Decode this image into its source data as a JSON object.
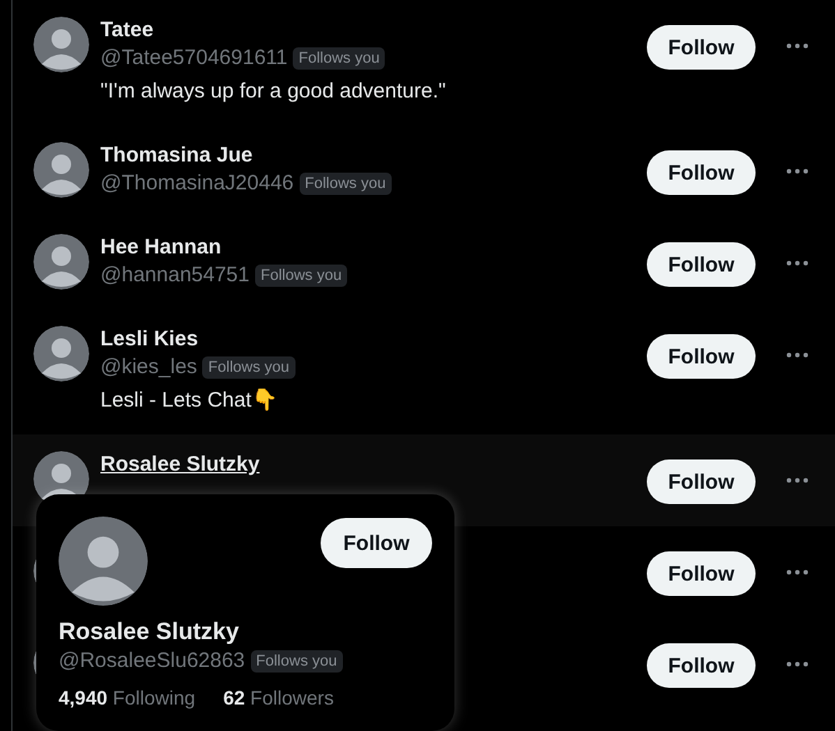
{
  "users": [
    {
      "kind": "listed",
      "name": "Tatee",
      "handle": "@Tatee5704691611",
      "badge": "Follows you",
      "bio": "\"I'm always up for a good adventure.\"",
      "hovered": false,
      "button": "Follow"
    },
    {
      "kind": "listed",
      "name": "Thomasina Jue",
      "handle": "@ThomasinaJ20446",
      "badge": "Follows you",
      "hovered": false,
      "button": "Follow"
    },
    {
      "kind": "listed",
      "name": "Hee Hannan",
      "handle": "@hannan54751",
      "badge": "Follows you",
      "hovered": false,
      "button": "Follow"
    },
    {
      "kind": "listed",
      "name": "Lesli Kies",
      "handle": "@kies_les",
      "badge": "Follows you",
      "bio": "Lesli - Lets Chat👇",
      "hovered": false,
      "button": "Follow"
    },
    {
      "kind": "listed",
      "name": "Rosalee Slutzky",
      "hovered": true,
      "button": "Follow"
    },
    {
      "kind": "covered",
      "button": "Follow"
    },
    {
      "kind": "covered",
      "button": "Follow"
    }
  ],
  "hover_card": {
    "button": "Follow",
    "name": "Rosalee Slutzky",
    "handle": "@RosaleeSlu62863",
    "badge": "Follows you",
    "following_count": "4,940",
    "following_label": "Following",
    "followers_count": "62",
    "followers_label": "Followers"
  }
}
